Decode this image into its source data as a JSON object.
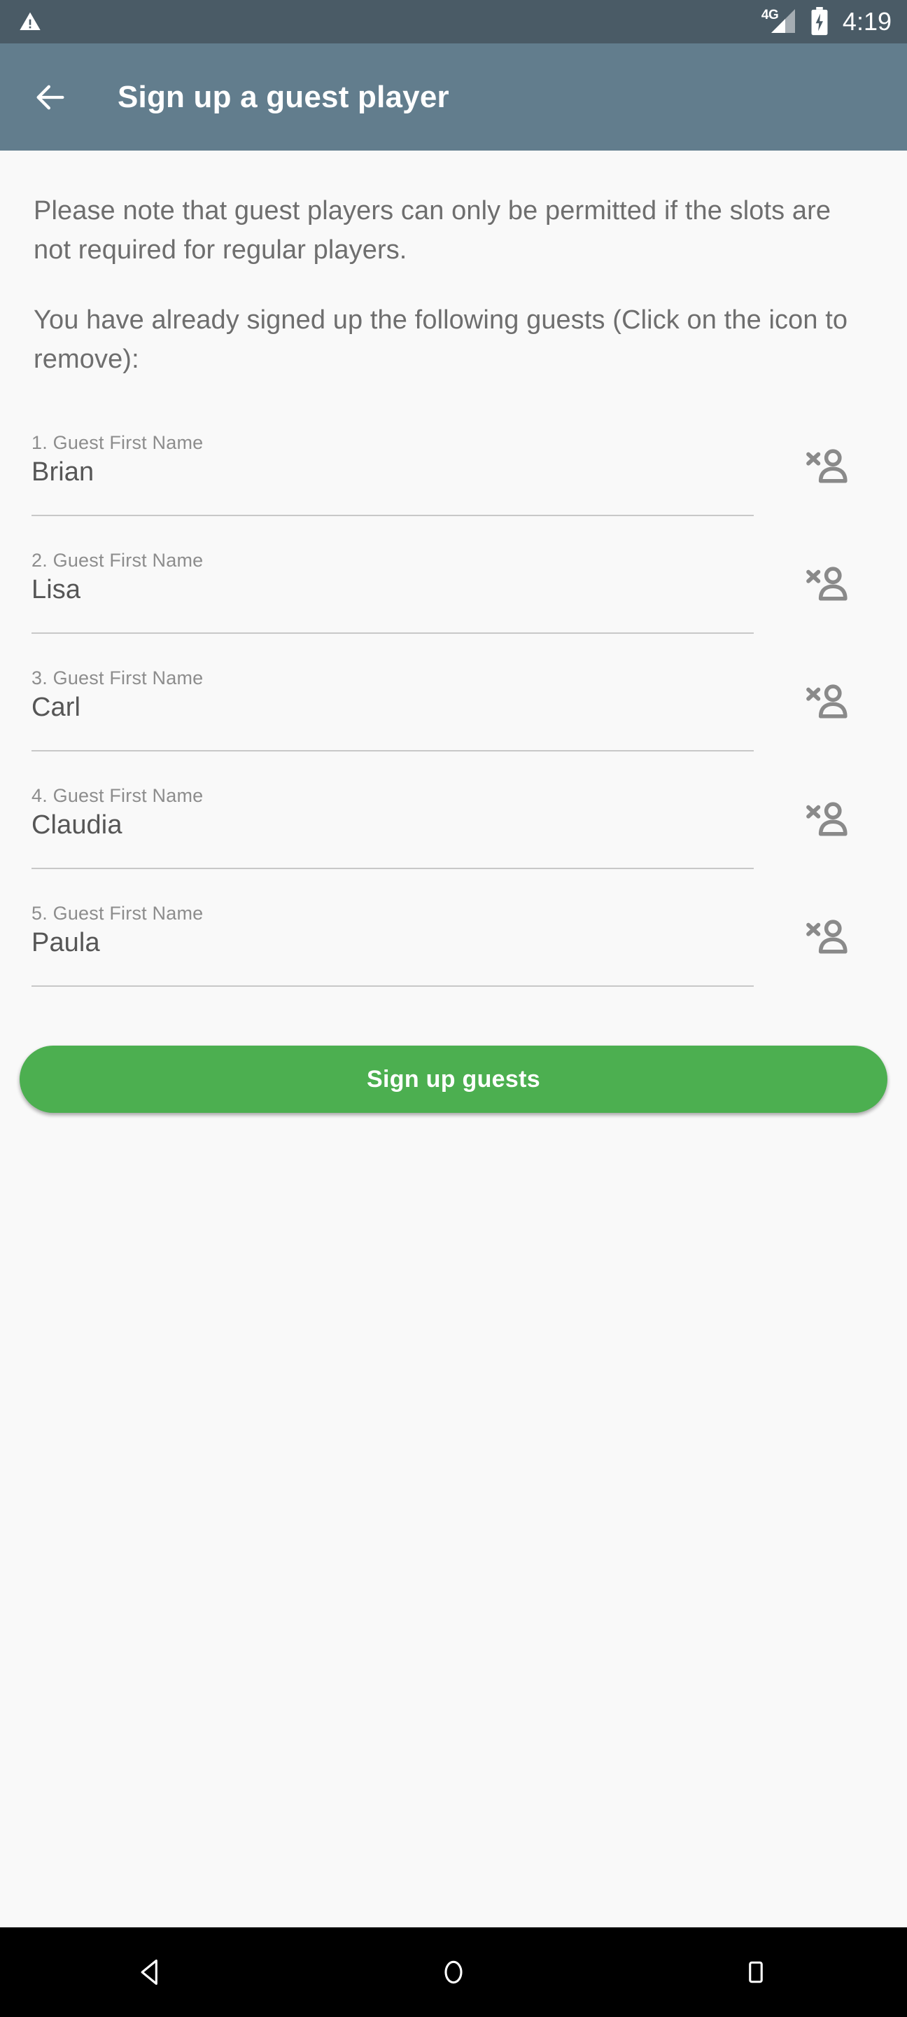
{
  "statusbar": {
    "warning_icon": "warning-triangle-icon",
    "network_label": "4G",
    "signal_icon": "signal-bars-icon",
    "battery_icon": "battery-charging-icon",
    "time": "4:19"
  },
  "appbar": {
    "back_icon": "arrow-back-icon",
    "title": "Sign up a guest player",
    "background_color": "#627d8d"
  },
  "content": {
    "note_paragraph": "Please note that guest players can only be permitted if the slots are not required for regular players.",
    "instruction_paragraph": "You have already signed up the following guests (Click on the icon to remove):"
  },
  "guests": [
    {
      "label": "1. Guest First Name",
      "value": "Brian",
      "remove_icon": "person-remove-icon"
    },
    {
      "label": "2. Guest First Name",
      "value": "Lisa",
      "remove_icon": "person-remove-icon"
    },
    {
      "label": "3. Guest First Name",
      "value": "Carl",
      "remove_icon": "person-remove-icon"
    },
    {
      "label": "4. Guest First Name",
      "value": "Claudia",
      "remove_icon": "person-remove-icon"
    },
    {
      "label": "5. Guest First Name",
      "value": "Paula",
      "remove_icon": "person-remove-icon"
    }
  ],
  "primary_button": {
    "label": "Sign up guests",
    "color": "#4caf50"
  },
  "navbar": {
    "back_icon": "nav-back-triangle-icon",
    "home_icon": "nav-home-circle-icon",
    "recents_icon": "nav-recents-square-icon"
  }
}
